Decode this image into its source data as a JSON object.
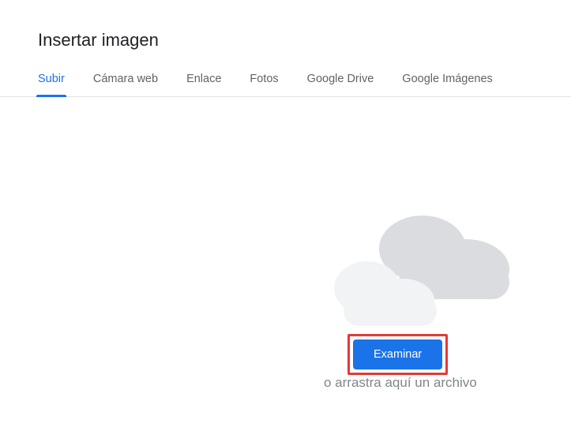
{
  "dialog": {
    "title": "Insertar imagen"
  },
  "tabs": {
    "items": [
      {
        "label": "Subir"
      },
      {
        "label": "Cámara web"
      },
      {
        "label": "Enlace"
      },
      {
        "label": "Fotos"
      },
      {
        "label": "Google Drive"
      },
      {
        "label": "Google Imágenes"
      }
    ],
    "active_index": 0
  },
  "upload": {
    "browse_label": "Examinar",
    "drag_text": "o arrastra aquí un archivo"
  },
  "colors": {
    "accent": "#1a73e8",
    "highlight_border": "#e53935",
    "muted_text": "#80868b"
  }
}
